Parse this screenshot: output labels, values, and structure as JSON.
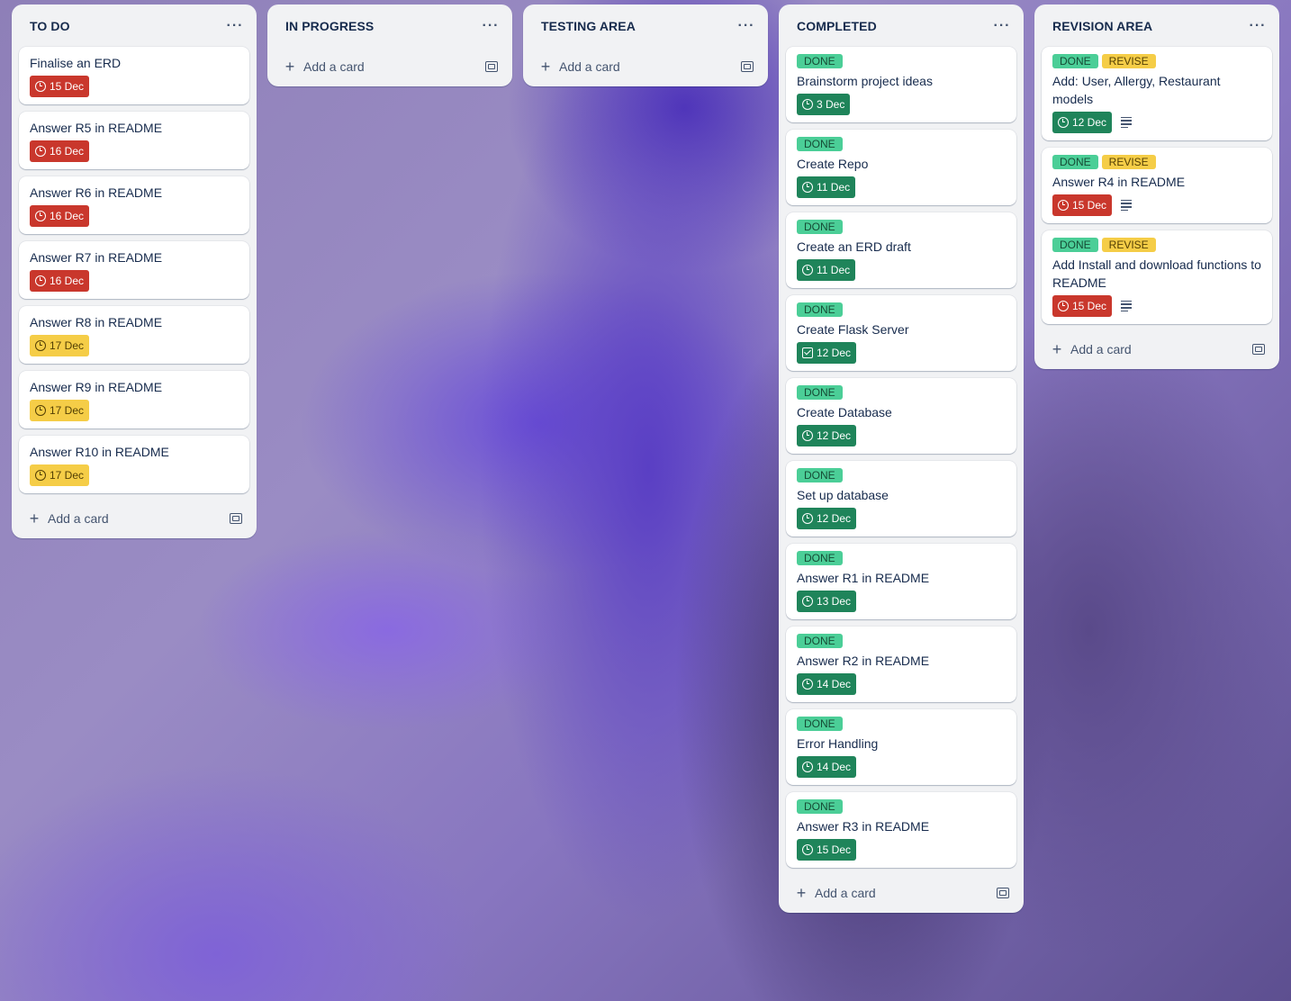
{
  "lists": [
    {
      "title": "TO DO",
      "menu_icon": "ellipsis-icon",
      "add_label": "Add a card",
      "cards": [
        {
          "title": "Finalise an ERD",
          "labels": [],
          "due": "15 Dec",
          "due_status": "overdue",
          "due_icon": "clock-icon",
          "has_description": false
        },
        {
          "title": "Answer R5 in README",
          "labels": [],
          "due": "16 Dec",
          "due_status": "overdue",
          "due_icon": "clock-icon",
          "has_description": false
        },
        {
          "title": "Answer R6 in README",
          "labels": [],
          "due": "16 Dec",
          "due_status": "overdue",
          "due_icon": "clock-icon",
          "has_description": false
        },
        {
          "title": "Answer R7 in README",
          "labels": [],
          "due": "16 Dec",
          "due_status": "overdue",
          "due_icon": "clock-icon",
          "has_description": false
        },
        {
          "title": "Answer R8 in README",
          "labels": [],
          "due": "17 Dec",
          "due_status": "soon",
          "due_icon": "clock-icon",
          "has_description": false
        },
        {
          "title": "Answer R9 in README",
          "labels": [],
          "due": "17 Dec",
          "due_status": "soon",
          "due_icon": "clock-icon",
          "has_description": false
        },
        {
          "title": "Answer R10 in README",
          "labels": [],
          "due": "17 Dec",
          "due_status": "soon",
          "due_icon": "clock-icon",
          "has_description": false
        }
      ]
    },
    {
      "title": "IN PROGRESS",
      "menu_icon": "ellipsis-icon",
      "add_label": "Add a card",
      "cards": []
    },
    {
      "title": "TESTING AREA",
      "menu_icon": "ellipsis-icon",
      "add_label": "Add a card",
      "cards": []
    },
    {
      "title": "COMPLETED",
      "menu_icon": "ellipsis-icon",
      "add_label": "Add a card",
      "cards": [
        {
          "title": "Brainstorm project ideas",
          "labels": [
            {
              "text": "DONE",
              "color": "green"
            }
          ],
          "due": "3 Dec",
          "due_status": "complete",
          "due_icon": "clock-icon",
          "has_description": false
        },
        {
          "title": "Create Repo",
          "labels": [
            {
              "text": "DONE",
              "color": "green"
            }
          ],
          "due": "11 Dec",
          "due_status": "complete",
          "due_icon": "clock-icon",
          "has_description": false
        },
        {
          "title": "Create an ERD draft",
          "labels": [
            {
              "text": "DONE",
              "color": "green"
            }
          ],
          "due": "11 Dec",
          "due_status": "complete",
          "due_icon": "clock-icon",
          "has_description": false
        },
        {
          "title": "Create Flask Server",
          "labels": [
            {
              "text": "DONE",
              "color": "green"
            }
          ],
          "due": "12 Dec",
          "due_status": "complete",
          "due_icon": "checkbox-icon",
          "has_description": false
        },
        {
          "title": "Create Database",
          "labels": [
            {
              "text": "DONE",
              "color": "green"
            }
          ],
          "due": "12 Dec",
          "due_status": "complete",
          "due_icon": "clock-icon",
          "has_description": false
        },
        {
          "title": "Set up database",
          "labels": [
            {
              "text": "DONE",
              "color": "green"
            }
          ],
          "due": "12 Dec",
          "due_status": "complete",
          "due_icon": "clock-icon",
          "has_description": false
        },
        {
          "title": "Answer R1 in README",
          "labels": [
            {
              "text": "DONE",
              "color": "green"
            }
          ],
          "due": "13 Dec",
          "due_status": "complete",
          "due_icon": "clock-icon",
          "has_description": false
        },
        {
          "title": "Answer R2 in README",
          "labels": [
            {
              "text": "DONE",
              "color": "green"
            }
          ],
          "due": "14 Dec",
          "due_status": "complete",
          "due_icon": "clock-icon",
          "has_description": false
        },
        {
          "title": "Error Handling",
          "labels": [
            {
              "text": "DONE",
              "color": "green"
            }
          ],
          "due": "14 Dec",
          "due_status": "complete",
          "due_icon": "clock-icon",
          "has_description": false
        },
        {
          "title": "Answer R3 in README",
          "labels": [
            {
              "text": "DONE",
              "color": "green"
            }
          ],
          "due": "15 Dec",
          "due_status": "complete",
          "due_icon": "clock-icon",
          "has_description": false
        }
      ]
    },
    {
      "title": "REVISION AREA",
      "menu_icon": "ellipsis-icon",
      "add_label": "Add a card",
      "cards": [
        {
          "title": "Add: User, Allergy, Restaurant models",
          "labels": [
            {
              "text": "DONE",
              "color": "green"
            },
            {
              "text": "REVISE",
              "color": "yellow"
            }
          ],
          "due": "12 Dec",
          "due_status": "complete",
          "due_icon": "clock-icon",
          "has_description": true
        },
        {
          "title": "Answer R4 in README",
          "labels": [
            {
              "text": "DONE",
              "color": "green"
            },
            {
              "text": "REVISE",
              "color": "yellow"
            }
          ],
          "due": "15 Dec",
          "due_status": "overdue",
          "due_icon": "clock-icon",
          "has_description": true
        },
        {
          "title": "Add Install and download functions to README",
          "labels": [
            {
              "text": "DONE",
              "color": "green"
            },
            {
              "text": "REVISE",
              "color": "yellow"
            }
          ],
          "due": "15 Dec",
          "due_status": "overdue",
          "due_icon": "clock-icon",
          "has_description": true
        }
      ]
    }
  ],
  "colors": {
    "list_bg": "#f1f2f4",
    "overdue": "#c9372c",
    "soon": "#f5cd47",
    "complete": "#1f845a",
    "label_green": "#4bce97",
    "label_yellow": "#f5cd47"
  }
}
